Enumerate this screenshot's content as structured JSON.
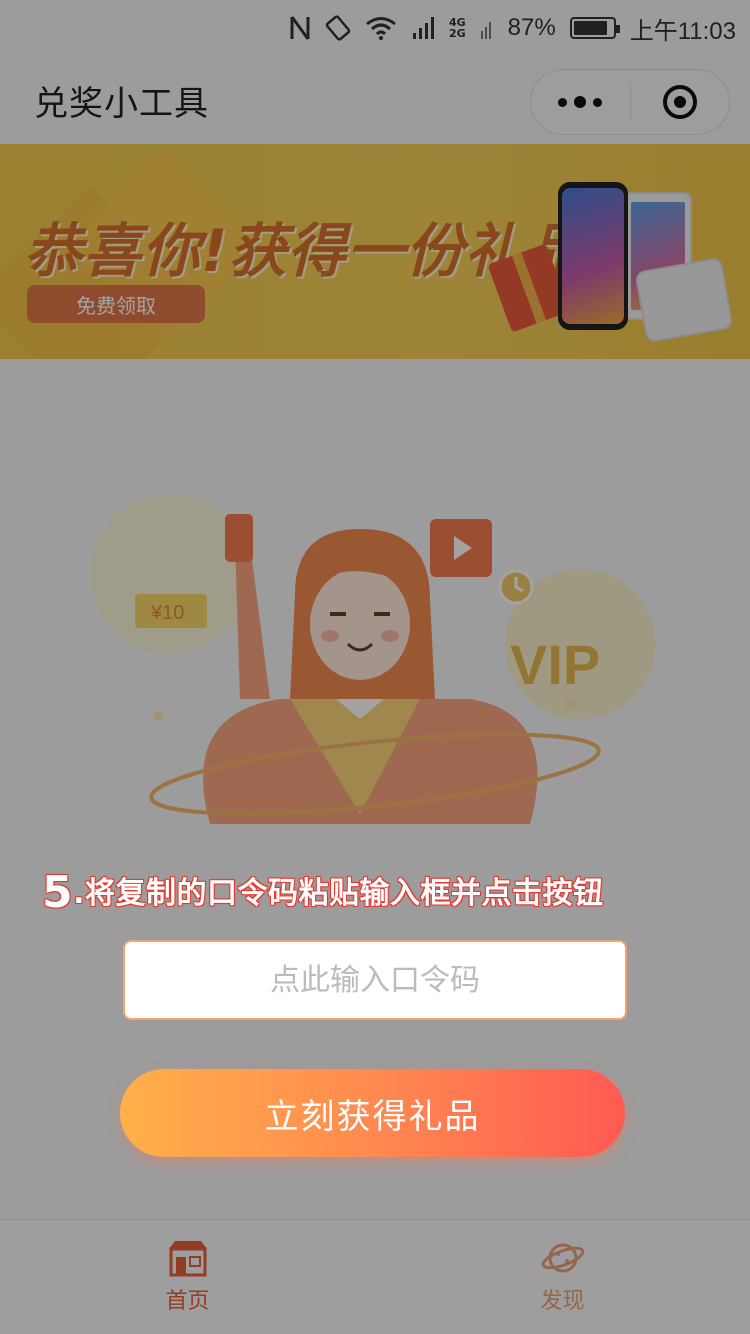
{
  "status_bar": {
    "battery_percent": "87%",
    "battery_level": 0.87,
    "time": "上午11:03",
    "network_label_top": "4G",
    "network_label_bottom": "2G"
  },
  "title_bar": {
    "title": "兑奖小工具"
  },
  "banner": {
    "headline": "恭喜你!获得一份礼品",
    "button_label": "免费领取"
  },
  "illustration": {
    "ticket_label": "¥10",
    "vip_label": "VIP"
  },
  "form": {
    "step_number": "5",
    "instruction": ".将复制的口令码粘贴输入框并点击按钮",
    "input_placeholder": "点此输入口令码",
    "submit_label": "立刻获得礼品"
  },
  "tabs": [
    {
      "label": "首页",
      "active": true,
      "icon": "store-icon"
    },
    {
      "label": "发现",
      "active": false,
      "icon": "planet-icon"
    }
  ],
  "colors": {
    "accent": "#ff6a4f",
    "button_gradient_start": "#ffb04a",
    "button_gradient_end": "#ff5a52",
    "banner_bg": "#f6cf58",
    "instruction_outline": "#e6372f"
  }
}
